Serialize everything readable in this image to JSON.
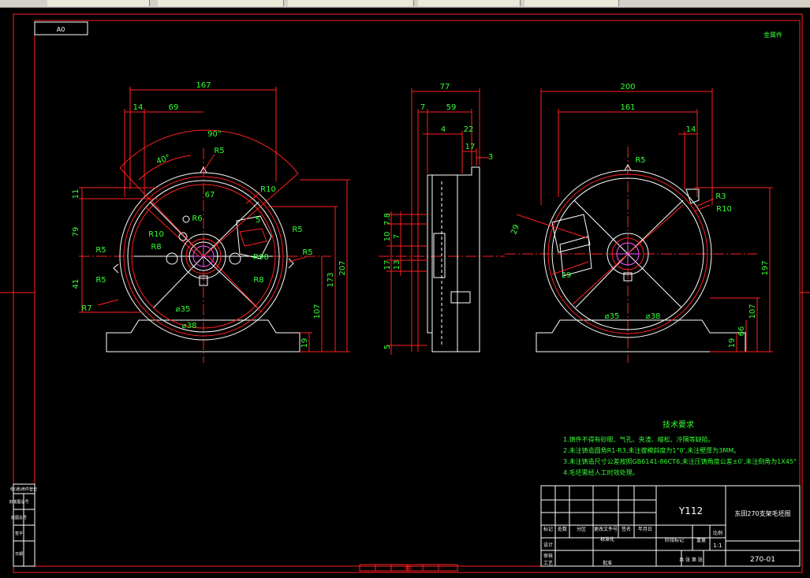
{
  "tabs": [
    "",
    "",
    "",
    "",
    ""
  ],
  "sheet": {
    "size_label": "A0",
    "corner_label": "金属件"
  },
  "front_view": {
    "dims_top": [
      "167",
      "14",
      "69"
    ],
    "angles": [
      "90°",
      "40°"
    ],
    "radii": [
      "R5",
      "R10",
      "R6",
      "R10",
      "R8",
      "R5",
      "R90",
      "R8",
      "R5",
      "R5",
      "R7",
      "R5",
      "5"
    ],
    "inner_width": "67",
    "left_dims": [
      "11",
      "79",
      "41"
    ],
    "diameters": [
      "⌀35",
      "⌀38"
    ],
    "right_dims": [
      "207",
      "173",
      "107",
      "19"
    ]
  },
  "side_view": {
    "top_dims": [
      "77",
      "7",
      "59",
      "4",
      "22",
      "17",
      "3"
    ],
    "left_dims": [
      "7.8",
      "10",
      "7",
      "17",
      "13",
      "5"
    ]
  },
  "rear_view": {
    "top_dims": [
      "200",
      "161",
      "14"
    ],
    "radii": [
      "R5",
      "R3",
      "R10"
    ],
    "slot_dims": [
      "29",
      "29"
    ],
    "diameters": [
      "⌀35",
      "⌀38"
    ],
    "right_dims": [
      "197",
      "107",
      "66",
      "19"
    ]
  },
  "tech_req": {
    "title": "技术要求",
    "lines": [
      "1.铸件不得有砂眼、气孔、夹渣、缩松、冷隔等缺陷。",
      "2.未注铸造圆角R1-R3,未注拔模斜度为1°0',未注壁厚为3MM。",
      "3.未注铸造尺寸公差按照GB6141-86CT6,未注压铸角度公差±0',未注倒角为1X45°",
      "4.毛坯需经人工时效处理。"
    ]
  },
  "title_block": {
    "model": "Y112",
    "part_name": "东田270支架毛坯图",
    "drawing_no": "270-01",
    "scale": "1:1",
    "rev_headers": [
      "标记",
      "处数",
      "分区",
      "更改文件号",
      "签名",
      "年月日"
    ],
    "row_labels": [
      "设计",
      "标准化",
      "审核",
      "工艺",
      "批准"
    ],
    "stage_headers": [
      "阶段标记",
      "重量",
      "比例"
    ],
    "sheet_line": "共  张  第  张"
  },
  "left_stamp": {
    "labels": [
      "借(通)用件登记",
      "旧底图总号",
      "底图总号",
      "签字",
      "日期"
    ]
  },
  "bottom_center_label": "中"
}
